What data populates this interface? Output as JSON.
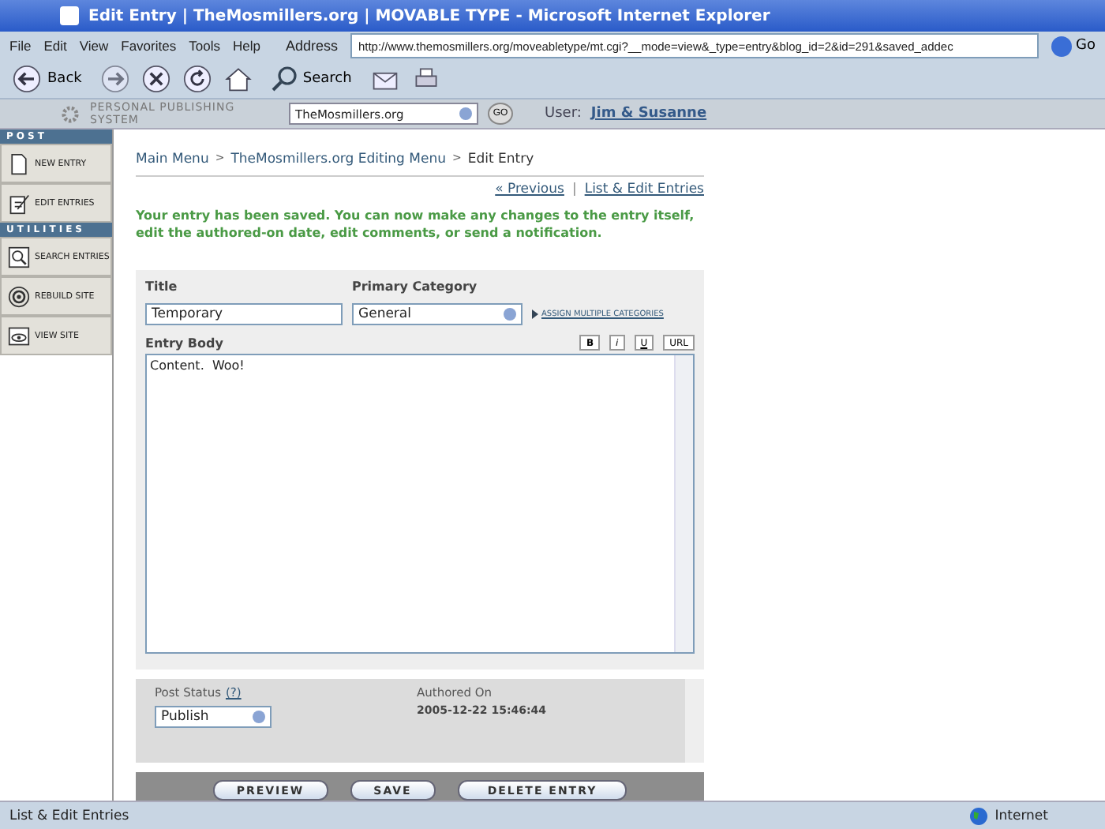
{
  "window": {
    "title": "Edit Entry | TheMosmillers.org | MOVABLE TYPE - Microsoft Internet Explorer"
  },
  "menu": [
    "File",
    "Edit",
    "View",
    "Favorites",
    "Tools",
    "Help"
  ],
  "address": {
    "label": "Address",
    "value": "http://www.themosmillers.org/moveabletype/mt.cgi?__mode=view&_type=entry&blog_id=2&id=291&saved_addec",
    "go": "Go"
  },
  "toolbar": {
    "back": "Back",
    "search": "Search"
  },
  "mt_header": {
    "tagline": "PERSONAL PUBLISHING SYSTEM",
    "blog": "TheMosmillers.org",
    "go": "GO",
    "user_label": "User:",
    "user": "Jim & Susanne"
  },
  "sidebar": [
    {
      "heading": "POST",
      "items": [
        {
          "label": "NEW ENTRY"
        },
        {
          "label": "EDIT ENTRIES"
        }
      ]
    },
    {
      "heading": "UTILITIES",
      "items": [
        {
          "label": "SEARCH ENTRIES"
        },
        {
          "label": "REBUILD SITE"
        },
        {
          "label": "VIEW SITE"
        }
      ]
    }
  ],
  "breadcrumb": [
    {
      "label": "Main Menu"
    },
    {
      "separator": ">",
      "label": "TheMosmillers.org Editing Menu"
    },
    {
      "separator": ">",
      "label": "Edit Entry"
    }
  ],
  "nav_links": [
    {
      "label": "« Previous"
    },
    {
      "separator": "|",
      "label": "List & Edit Entries"
    }
  ],
  "message": "Your entry has been saved. You can now make any changes to the entry itself, edit the authored-on date, edit comments, or send a notification.",
  "form": {
    "title_label": "Title",
    "title_value": "Temporary",
    "category_label": "Primary Category",
    "category_value": "General",
    "assign_link": "ASSIGN MULTIPLE CATEGORIES",
    "body_label": "Entry Body",
    "format_buttons": [
      "B",
      "i",
      "U",
      "URL"
    ],
    "body_value": "Content.  Woo!"
  },
  "status": {
    "label": "Post Status",
    "help": "(?)",
    "value": "Publish",
    "authored_label": "Authored On",
    "authored_value": "2005-12-22 15:46:44"
  },
  "buttons": [
    "PREVIEW",
    "SAVE",
    "DELETE ENTRY"
  ],
  "status_bar": {
    "text": "List & Edit Entries",
    "zone": "Internet"
  }
}
